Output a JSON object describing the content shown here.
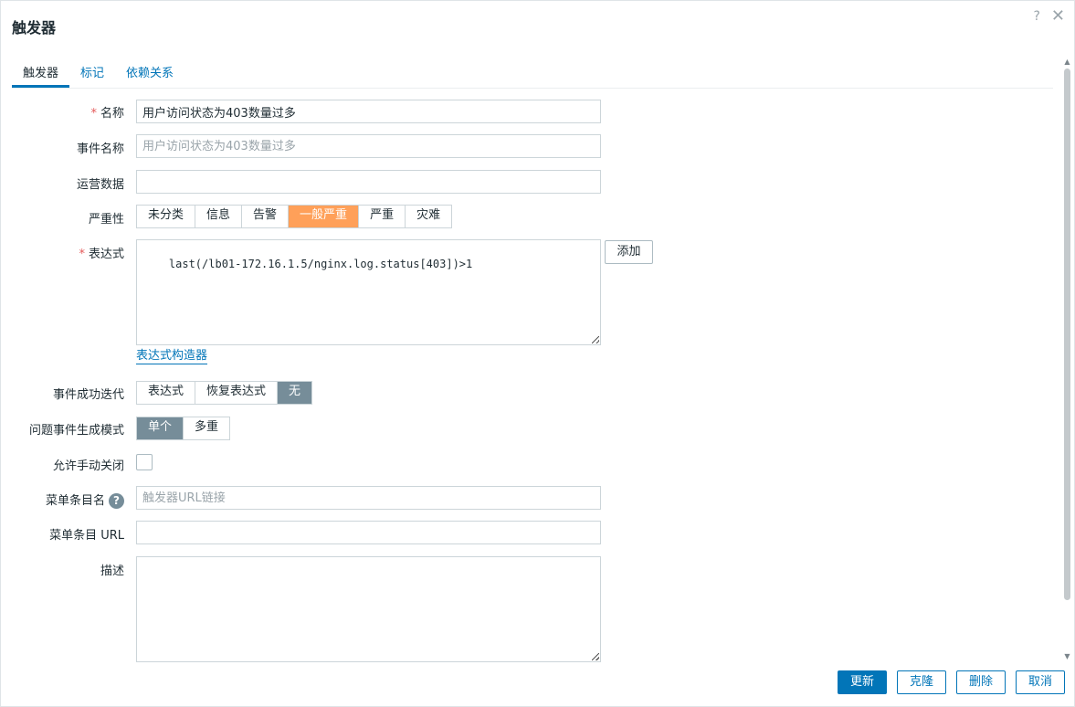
{
  "dialog": {
    "title": "触发器",
    "help_icon": "?",
    "close_icon": "✕"
  },
  "tabs": [
    {
      "label": "触发器",
      "active": true
    },
    {
      "label": "标记",
      "active": false
    },
    {
      "label": "依赖关系",
      "active": false
    }
  ],
  "form": {
    "name": {
      "label": "名称",
      "value": "用户访问状态为403数量过多"
    },
    "event_name": {
      "label": "事件名称",
      "placeholder": "用户访问状态为403数量过多"
    },
    "opdata": {
      "label": "运营数据",
      "value": ""
    },
    "severity": {
      "label": "严重性",
      "options": [
        "未分类",
        "信息",
        "告警",
        "一般严重",
        "严重",
        "灾难"
      ],
      "selected": "一般严重"
    },
    "expression": {
      "label": "表达式",
      "value": "last(/lb01-172.16.1.5/nginx.log.status[403])>1",
      "add_button": "添加",
      "constructor_link": "表达式构造器"
    },
    "ok_event_generation": {
      "label": "事件成功迭代",
      "options": [
        "表达式",
        "恢复表达式",
        "无"
      ],
      "selected": "无"
    },
    "problem_event_mode": {
      "label": "问题事件生成模式",
      "options": [
        "单个",
        "多重"
      ],
      "selected": "单个"
    },
    "manual_close": {
      "label": "允许手动关闭",
      "checked": false
    },
    "url_name": {
      "label": "菜单条目名",
      "placeholder": "触发器URL链接"
    },
    "url": {
      "label": "菜单条目 URL",
      "value": ""
    },
    "description": {
      "label": "描述",
      "value": ""
    }
  },
  "footer": {
    "update": "更新",
    "clone": "克隆",
    "delete": "删除",
    "cancel": "取消"
  },
  "colors": {
    "accent": "#0275b8",
    "severity_average": "#ffa059",
    "selected_gray": "#768d99",
    "required": "#e45959"
  }
}
